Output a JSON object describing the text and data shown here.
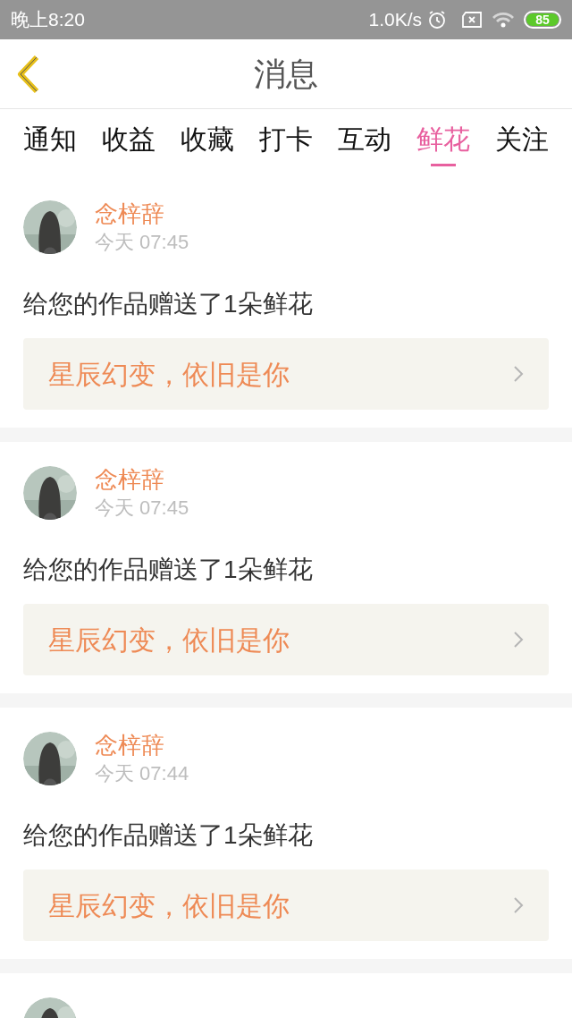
{
  "status_bar": {
    "time": "晚上8:20",
    "net_speed": "1.0K/s",
    "battery": "85"
  },
  "header": {
    "title": "消息"
  },
  "tabs": [
    {
      "label": "通知",
      "selected": false
    },
    {
      "label": "收益",
      "selected": false
    },
    {
      "label": "收藏",
      "selected": false
    },
    {
      "label": "打卡",
      "selected": false
    },
    {
      "label": "互动",
      "selected": false
    },
    {
      "label": "鲜花",
      "selected": true
    },
    {
      "label": "关注",
      "selected": false
    }
  ],
  "messages": [
    {
      "user": "念梓辞",
      "time": "今天 07:45",
      "text": "给您的作品赠送了1朵鲜花",
      "work": "星辰幻变，依旧是你"
    },
    {
      "user": "念梓辞",
      "time": "今天 07:45",
      "text": "给您的作品赠送了1朵鲜花",
      "work": "星辰幻变，依旧是你"
    },
    {
      "user": "念梓辞",
      "time": "今天 07:44",
      "text": "给您的作品赠送了1朵鲜花",
      "work": "星辰幻变，依旧是你"
    },
    {
      "kind": "picture"
    }
  ]
}
